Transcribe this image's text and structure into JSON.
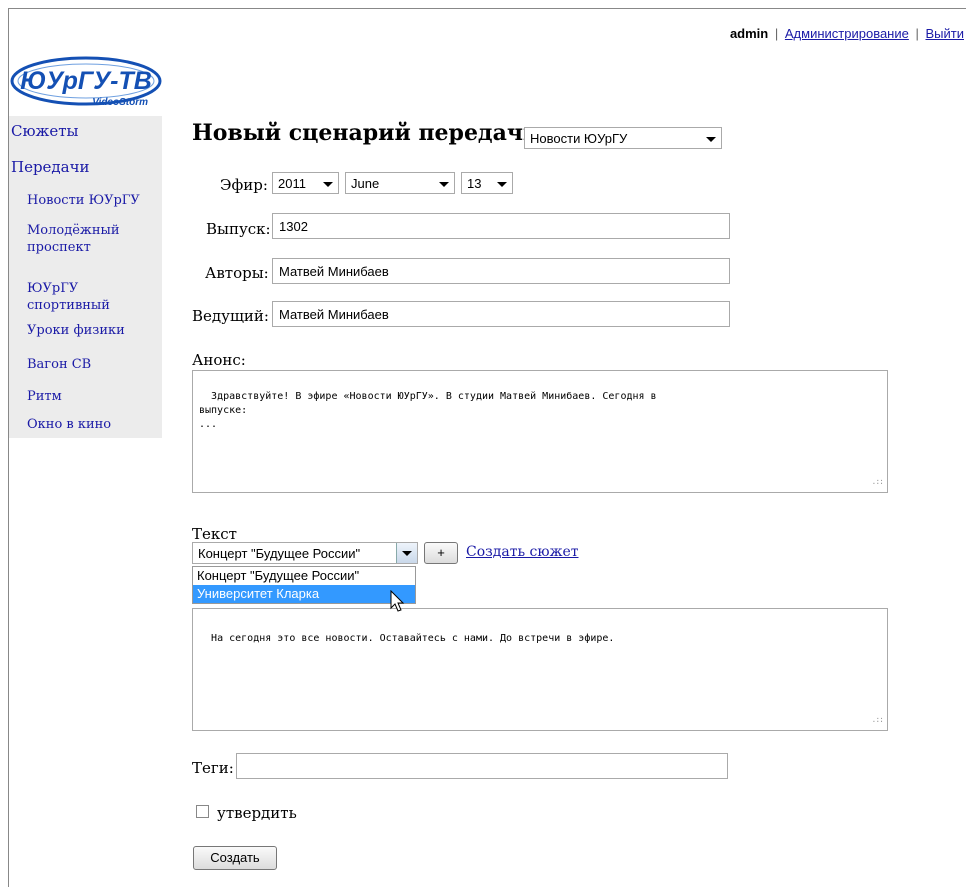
{
  "header": {
    "user": "admin",
    "separator": "|",
    "admin_link": "Администрирование",
    "logout_link": "Выйти"
  },
  "logo": {
    "main_text": "ЮУрГУ-ТВ",
    "sub_text": "VideoStorm"
  },
  "sidebar": {
    "items": [
      {
        "label": "Сюжеты"
      },
      {
        "label": "Передачи"
      }
    ],
    "subitems": [
      {
        "label": "Новости ЮУрГУ"
      },
      {
        "label": "Молодёжный проспект"
      },
      {
        "label": "ЮУрГУ спортивный"
      },
      {
        "label": "Уроки физики"
      },
      {
        "label": "Вагон СВ"
      },
      {
        "label": "Ритм"
      },
      {
        "label": "Окно в кино"
      }
    ]
  },
  "form": {
    "title": "Новый сценарий передачи",
    "program_select": "Новости ЮУрГУ",
    "air_label": "Эфир:",
    "air_year": "2011",
    "air_month": "June",
    "air_day": "13",
    "issue_label": "Выпуск:",
    "issue_value": "1302",
    "authors_label": "Авторы:",
    "authors_value": "Матвей Минибаев",
    "host_label": "Ведущий:",
    "host_value": "Матвей Минибаев",
    "announce_label": "Анонс:",
    "announce_text": "Здравствуйте! В эфире «Новости ЮУрГУ». В студии Матвей Минибаев. Сегодня в\nвыпуске:\n...",
    "text_label": "Текст",
    "story_select": "Концерт \"Будущее России\"",
    "add_button": "+",
    "create_story_link": "Создать сюжет",
    "dropdown_options": [
      "Концерт \"Будущее России\"",
      "Университет Кларка"
    ],
    "body_text": "На сегодня это все новости. Оставайтесь с нами. До встречи в эфире.",
    "tags_label": "Теги:",
    "tags_value": "",
    "approve_label": "утвердить",
    "submit_button": "Создать"
  },
  "colors": {
    "link": "#1a1aa6",
    "sidebar_bg": "#ececec",
    "selection": "#3399ff",
    "logo_blue": "#1450b4"
  }
}
